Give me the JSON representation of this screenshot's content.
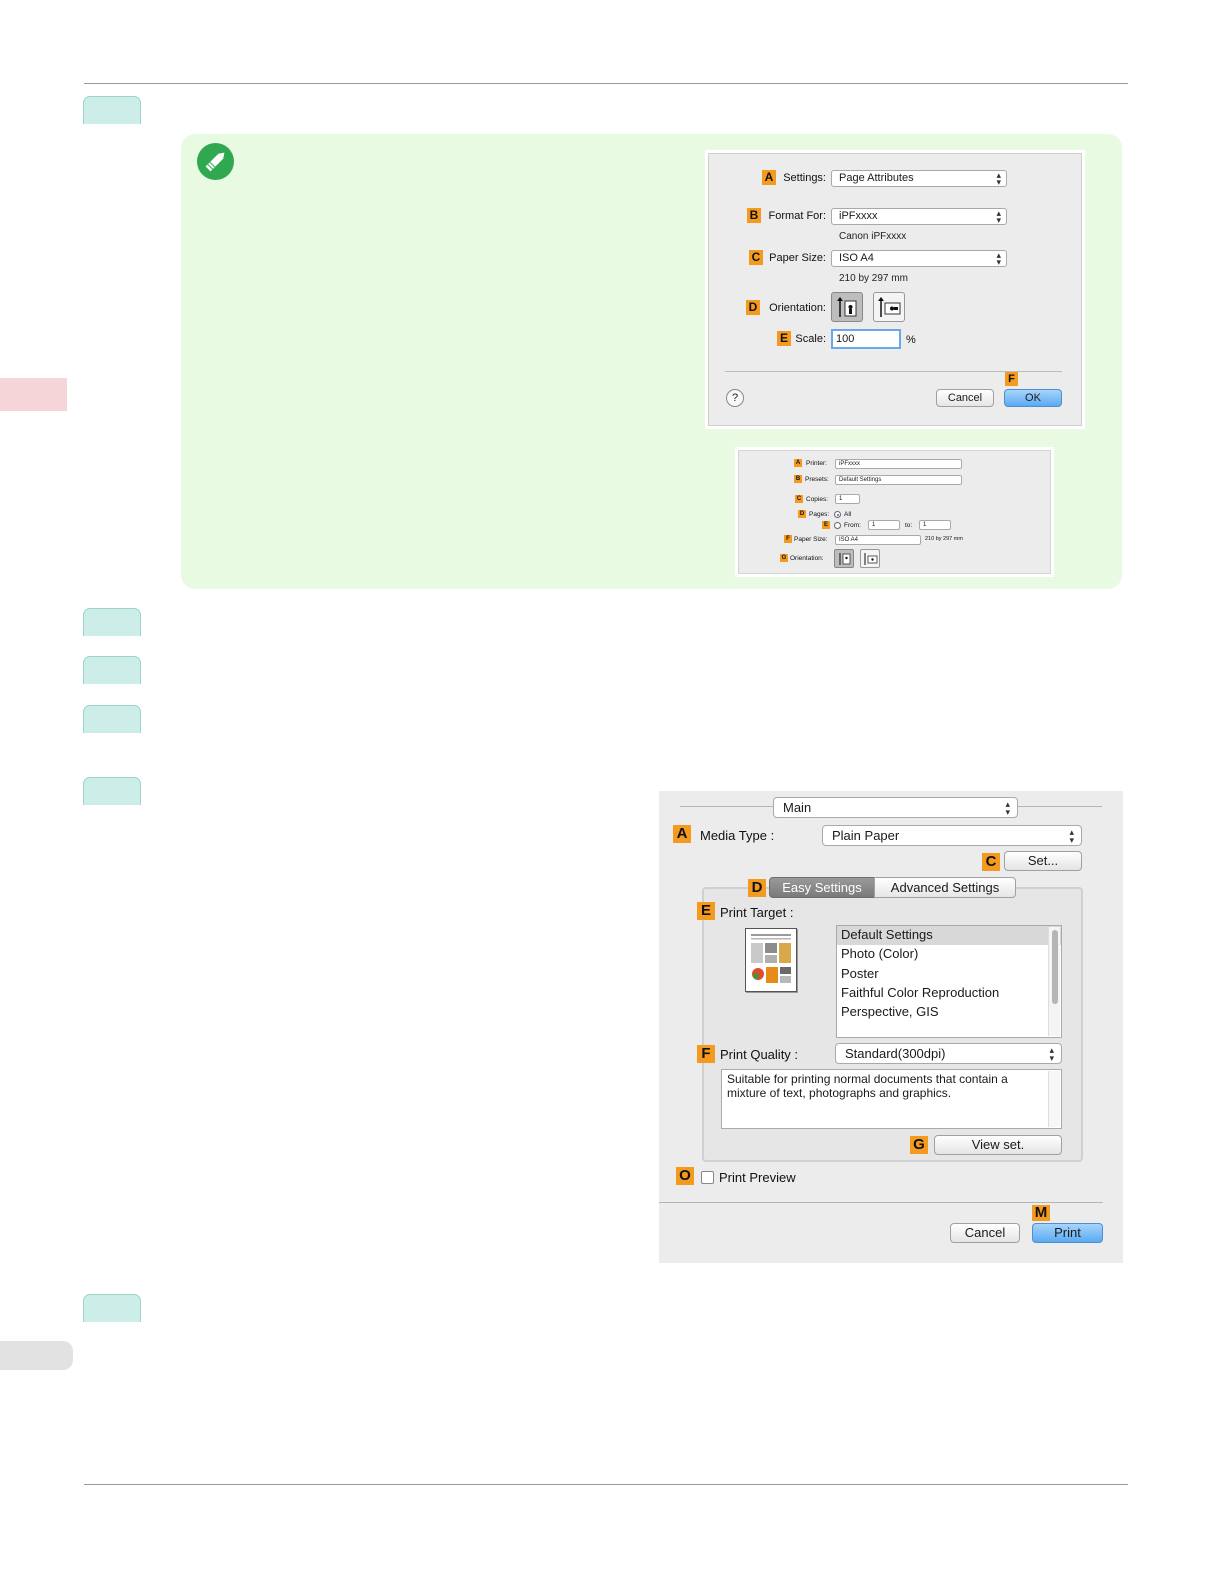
{
  "page_setup_dialog": {
    "settings": {
      "badge": "A",
      "label": "Settings:",
      "value": "Page Attributes"
    },
    "format_for": {
      "badge": "B",
      "label": "Format For:",
      "value": "iPFxxxx",
      "sub": "Canon iPFxxxx"
    },
    "paper_size": {
      "badge": "C",
      "label": "Paper Size:",
      "value": "ISO A4",
      "sub": "210 by 297 mm"
    },
    "orientation": {
      "badge": "D",
      "label": "Orientation:"
    },
    "scale": {
      "badge": "E",
      "label": "Scale:",
      "value": "100",
      "unit": "%"
    },
    "help": "?",
    "cancel": "Cancel",
    "ok": {
      "badge": "F",
      "label": "OK"
    }
  },
  "print_dialog_small": {
    "printer": {
      "badge": "A",
      "label": "Printer:",
      "value": "iPFxxxx"
    },
    "presets": {
      "badge": "B",
      "label": "Presets:",
      "value": "Default Settings"
    },
    "copies": {
      "badge": "C",
      "label": "Copies:",
      "value": "1"
    },
    "pages": {
      "badge": "D",
      "label": "Pages:",
      "all": "All"
    },
    "range": {
      "badge": "E",
      "from_label": "From:",
      "from": "1",
      "to_label": "to:",
      "to": "1"
    },
    "paper_size": {
      "badge": "F",
      "label": "Paper Size:",
      "value": "ISO A4",
      "sub": "210 by 297 mm"
    },
    "orientation": {
      "badge": "G",
      "label": "Orientation:"
    }
  },
  "main_dialog": {
    "panel": "Main",
    "media_type": {
      "badge": "A",
      "label": "Media Type :",
      "value": "Plain Paper"
    },
    "set_button": {
      "badge": "C",
      "label": "Set..."
    },
    "tabs": {
      "badge": "D",
      "easy": "Easy Settings",
      "advanced": "Advanced Settings"
    },
    "print_target": {
      "badge": "E",
      "label": "Print Target :",
      "items": [
        "Default Settings",
        "Photo (Color)",
        "Poster",
        "Faithful Color Reproduction",
        "Perspective, GIS"
      ]
    },
    "print_quality": {
      "badge": "F",
      "label": "Print Quality :",
      "value": "Standard(300dpi)"
    },
    "description": "Suitable for printing normal documents that contain a mixture of text, photographs and graphics.",
    "view_set": {
      "badge": "G",
      "label": "View set."
    },
    "print_preview": {
      "badge": "O",
      "label": "Print Preview"
    },
    "cancel": "Cancel",
    "print": {
      "badge": "M",
      "label": "Print"
    }
  }
}
